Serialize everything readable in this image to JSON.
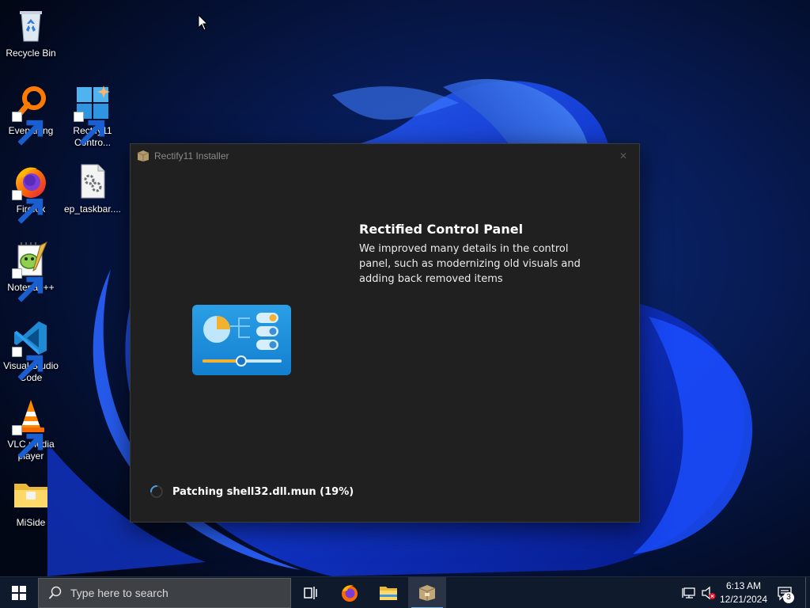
{
  "desktop": {
    "icons": [
      {
        "label": "Recycle Bin"
      },
      {
        "label": "Everything"
      },
      {
        "label": "Rectify11 Contro..."
      },
      {
        "label": "Firefox"
      },
      {
        "label": "ep_taskbar...."
      },
      {
        "label": "Notepad++"
      },
      {
        "label": "Visual Studio Code"
      },
      {
        "label": "VLC media player"
      },
      {
        "label": "MiSide"
      }
    ]
  },
  "installer": {
    "title": "Rectify11 Installer",
    "feature": {
      "title": "Rectified Control Panel",
      "description": "We improved many details in the control panel, such as modernizing old visuals and adding back removed items"
    },
    "status": "Patching shell32.dll.mun (19%)",
    "progress_percent": 19
  },
  "taskbar": {
    "search_placeholder": "Type here to search",
    "apps": [
      "task-view",
      "firefox",
      "file-explorer",
      "rectify11-installer"
    ],
    "active_app": "rectify11-installer",
    "clock": {
      "time": "6:13 AM",
      "date": "12/21/2024"
    },
    "notification_count": "3"
  },
  "colors": {
    "accent": "#0078d4",
    "taskbar_bg": "#0f1a2c",
    "window_bg": "#202020"
  }
}
